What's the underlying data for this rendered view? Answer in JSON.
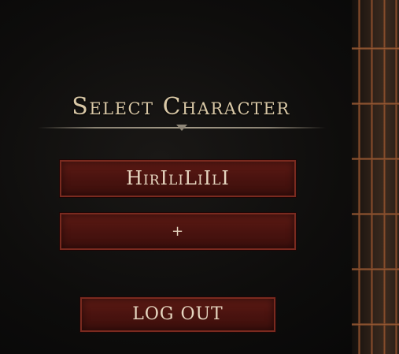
{
  "screen": {
    "title": "Select Character"
  },
  "characters": [
    {
      "name": "HirIliLiIlI"
    }
  ],
  "add_character": {
    "label": "+"
  },
  "logout": {
    "label": "LOG OUT"
  },
  "colors": {
    "button_fill": "#4a130f",
    "button_border": "#7a2a1f",
    "title_text": "#d9c8a6",
    "button_text": "#e6d6c0"
  }
}
